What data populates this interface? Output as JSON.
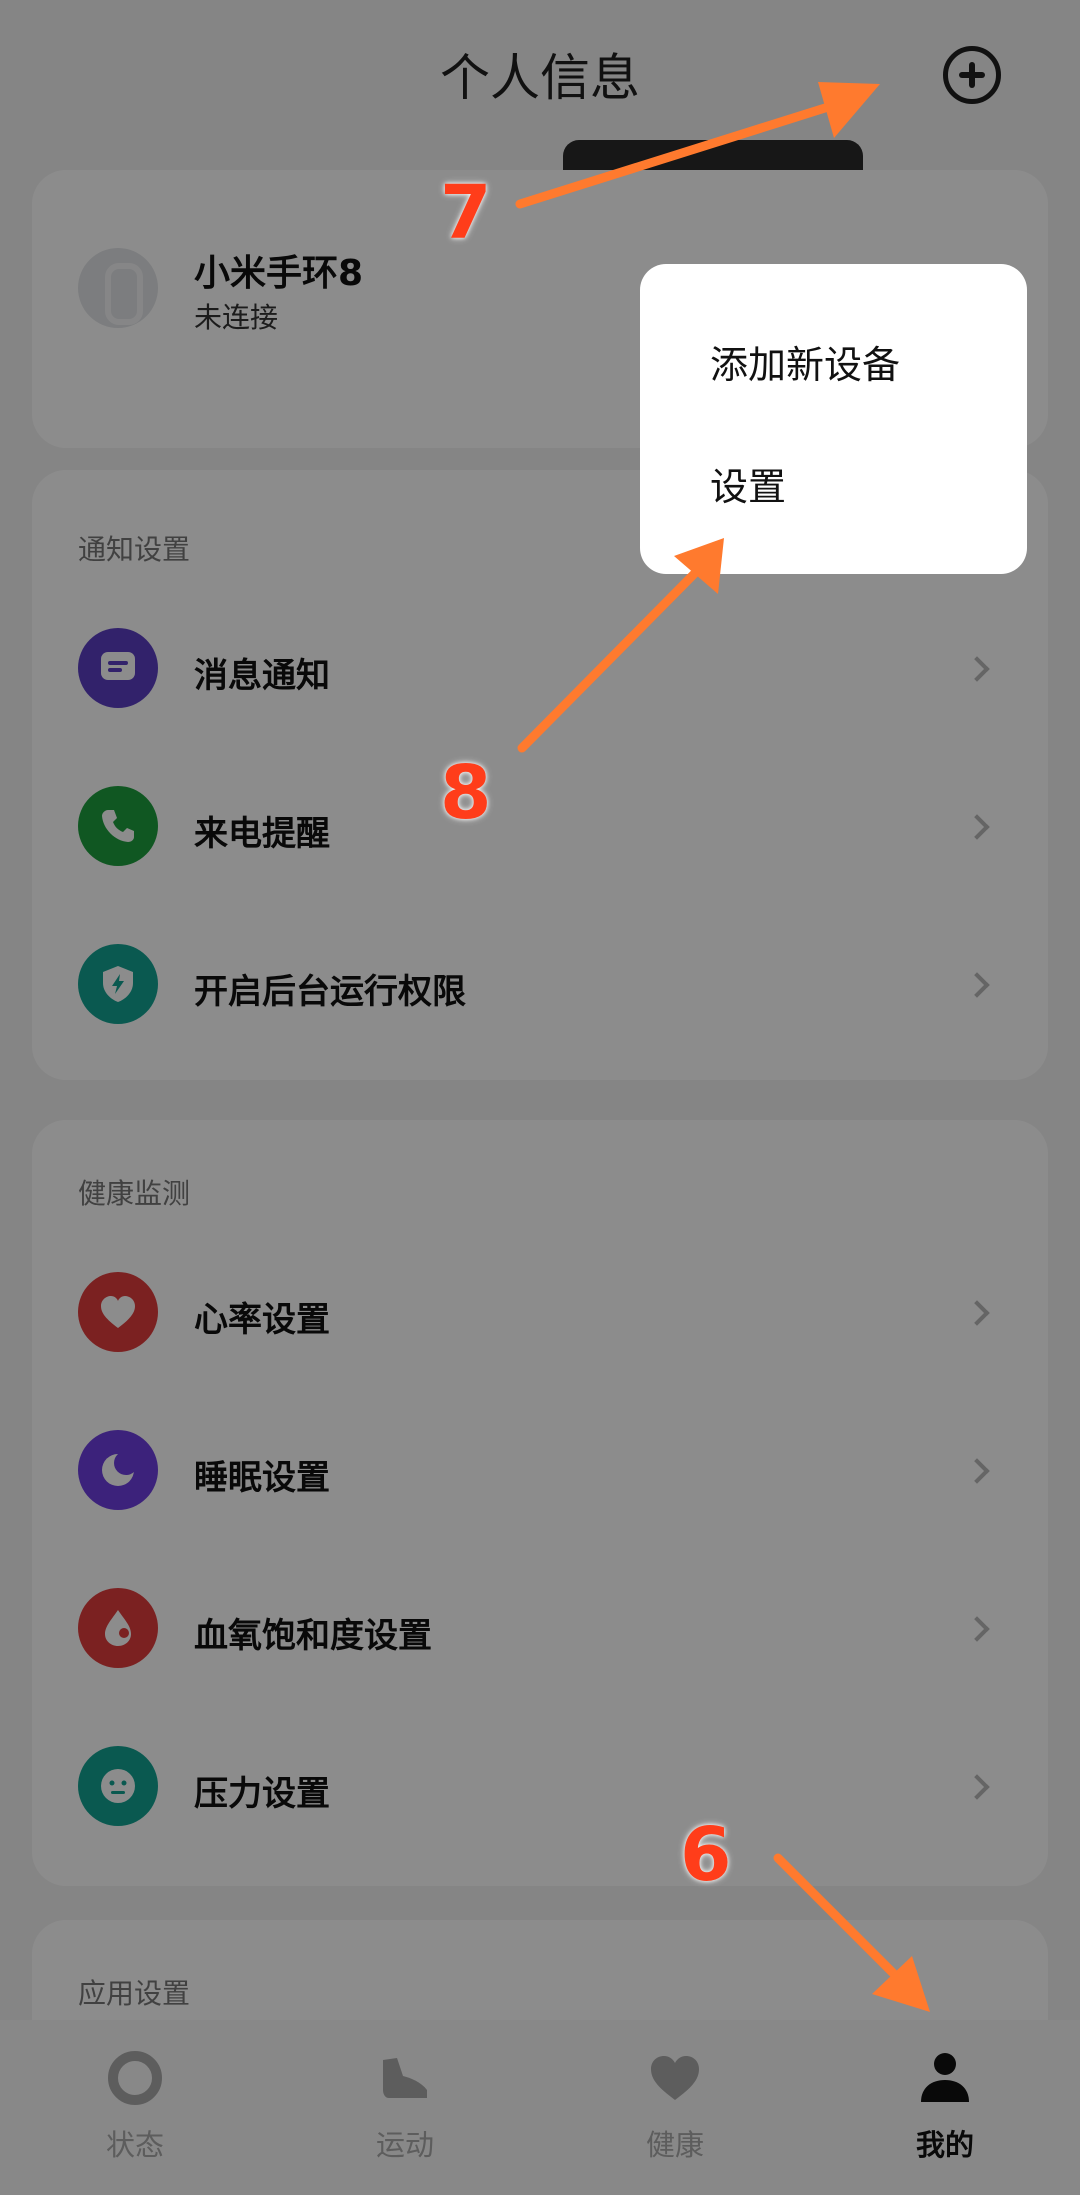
{
  "header": {
    "title": "个人信息",
    "add_icon": "plus-circle-icon"
  },
  "device": {
    "name": "小米手环8",
    "status": "未连接",
    "icon": "band-icon"
  },
  "notify_section": {
    "label": "通知设置",
    "items": [
      {
        "label": "消息通知",
        "icon": "message-icon",
        "color": "#5b3fc4"
      },
      {
        "label": "来电提醒",
        "icon": "phone-icon",
        "color": "#1e9e3e"
      },
      {
        "label": "开启后台运行权限",
        "icon": "shield-bolt-icon",
        "color": "#13a393"
      }
    ]
  },
  "health_section": {
    "label": "健康监测",
    "items": [
      {
        "label": "心率设置",
        "icon": "heart-icon",
        "color": "#e03c3c"
      },
      {
        "label": "睡眠设置",
        "icon": "moon-icon",
        "color": "#6d3fe0"
      },
      {
        "label": "血氧饱和度设置",
        "icon": "blood-drop-icon",
        "color": "#e03c3c"
      },
      {
        "label": "压力设置",
        "icon": "face-icon",
        "color": "#13a393"
      }
    ]
  },
  "app_section": {
    "label": "应用设置"
  },
  "tabbar": {
    "items": [
      {
        "label": "状态",
        "icon": "ring-icon",
        "active": false
      },
      {
        "label": "运动",
        "icon": "shoe-icon",
        "active": false
      },
      {
        "label": "健康",
        "icon": "heart-icon",
        "active": false
      },
      {
        "label": "我的",
        "icon": "person-icon",
        "active": true
      }
    ]
  },
  "popup_menu": {
    "items": [
      "添加新设备",
      "设置"
    ]
  },
  "annotations": {
    "step_6": "6",
    "step_7": "7",
    "step_8": "8",
    "arrow_color": "#ff7a2e"
  }
}
